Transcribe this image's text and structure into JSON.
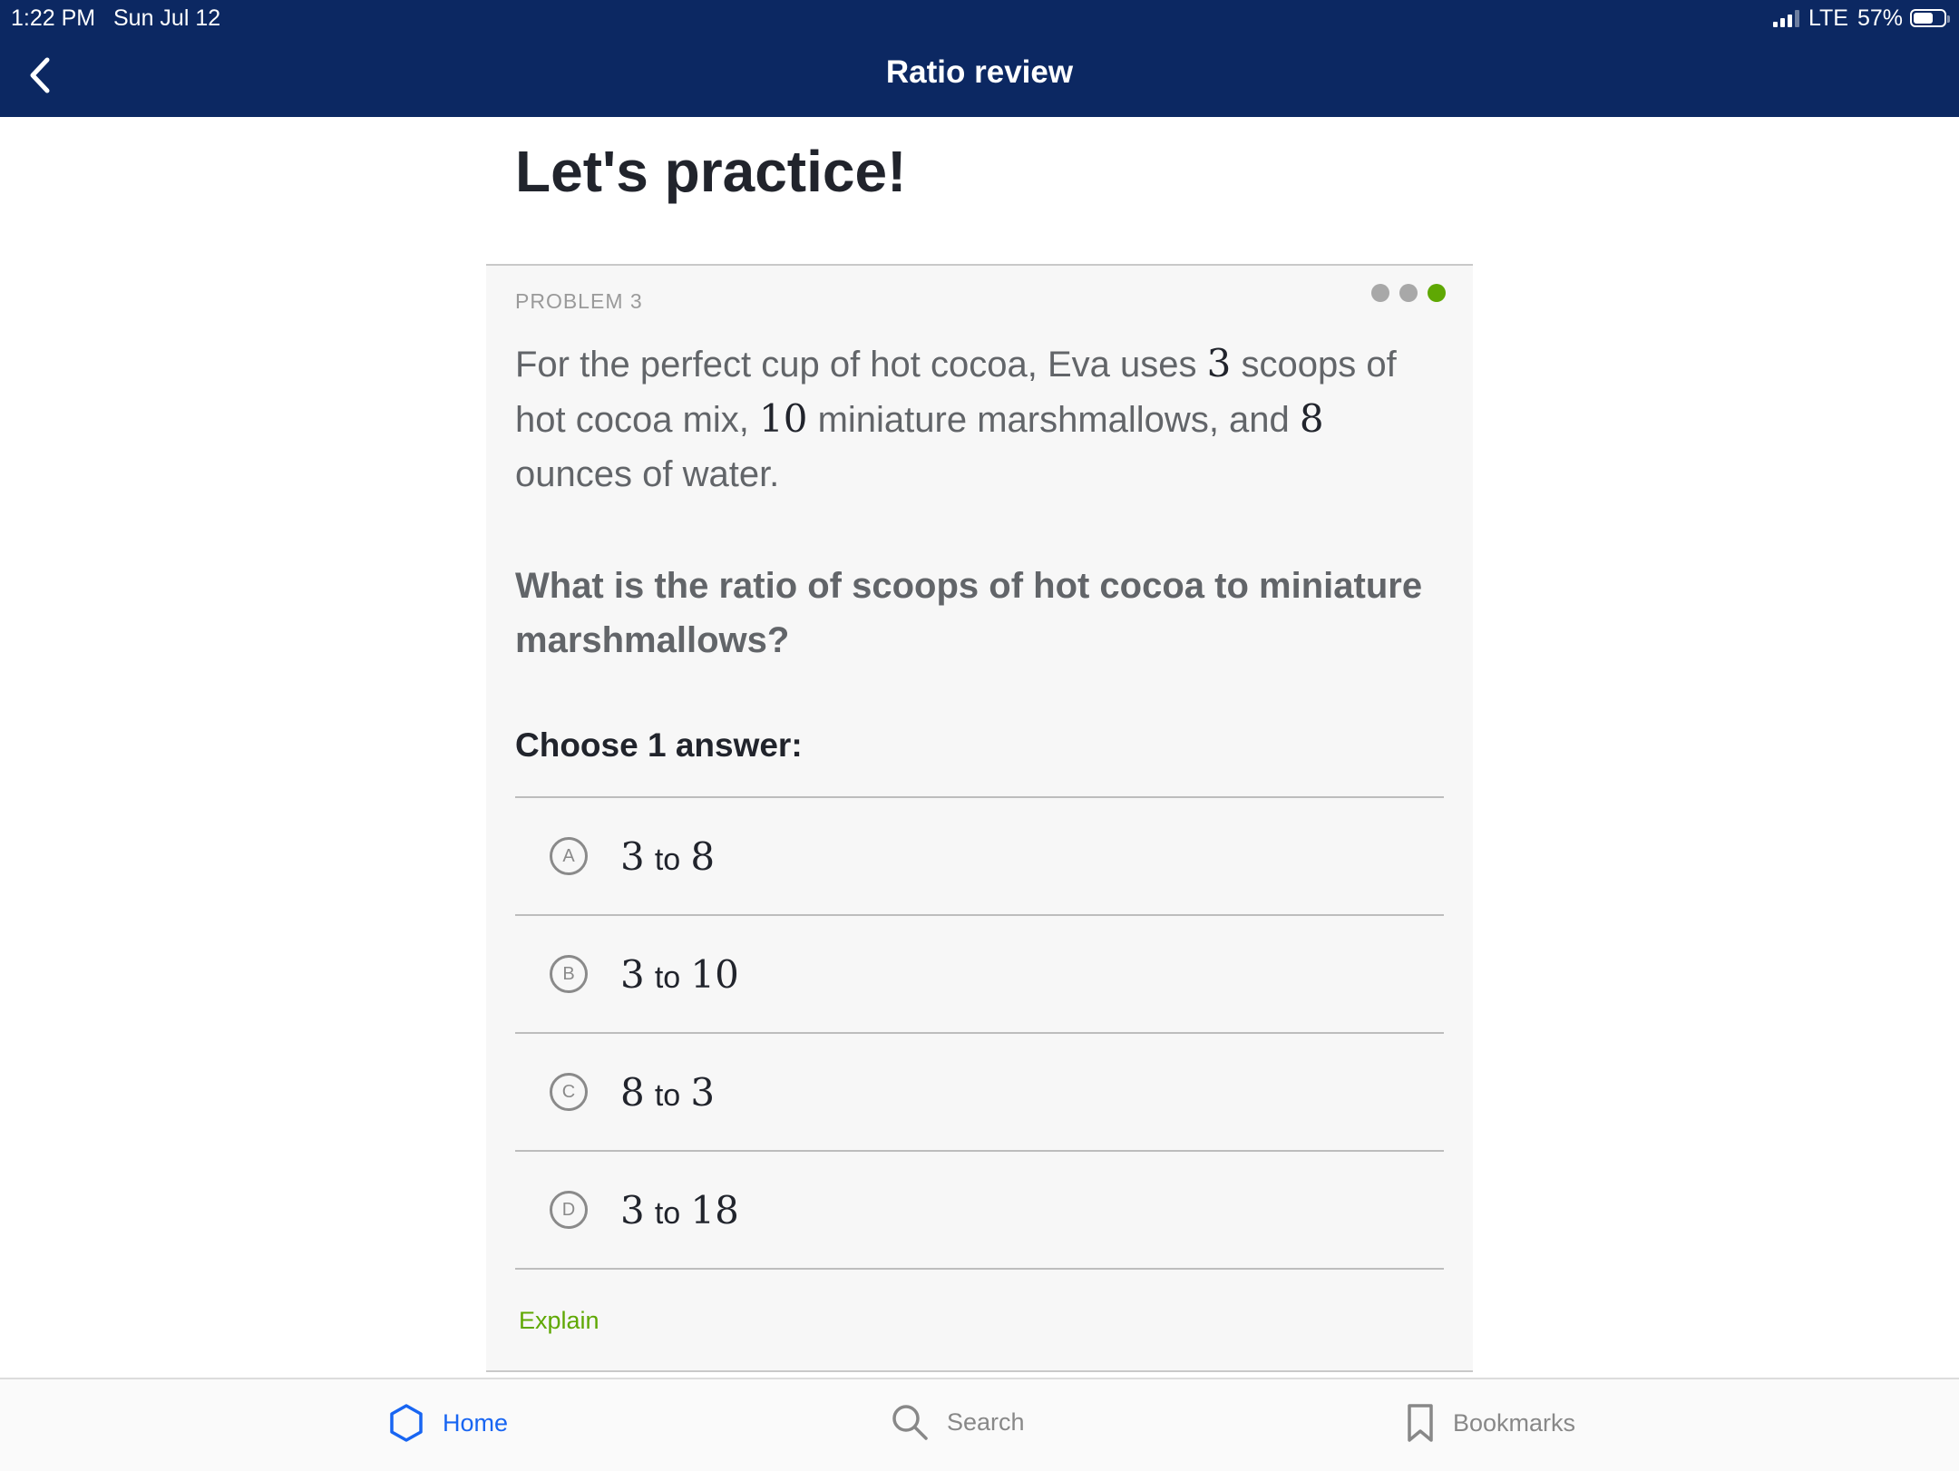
{
  "status": {
    "time": "1:22 PM",
    "date": "Sun Jul 12",
    "network": "LTE",
    "battery": "57%"
  },
  "nav": {
    "title": "Ratio review",
    "back_icon": "chevron-left-icon"
  },
  "page": {
    "heading": "Let's practice!"
  },
  "problem": {
    "label": "PROBLEM 3",
    "progress_dots": 3,
    "active_dot": 3,
    "text_parts": [
      "For the perfect cup of hot cocoa, Eva uses ",
      "3",
      " scoops of hot cocoa mix, ",
      "10",
      " miniature marshmallows, and ",
      "8",
      " ounces of water."
    ],
    "question": "What is the ratio of scoops of hot cocoa to miniature marshmallows?",
    "choose_label": "Choose 1 answer:",
    "choices": [
      {
        "letter": "A",
        "left": "3",
        "word": "to",
        "right": "8"
      },
      {
        "letter": "B",
        "left": "3",
        "word": "to",
        "right": "10"
      },
      {
        "letter": "C",
        "left": "8",
        "word": "to",
        "right": "3"
      },
      {
        "letter": "D",
        "left": "3",
        "word": "to",
        "right": "18"
      }
    ],
    "explain_label": "Explain"
  },
  "tabbar": {
    "home": {
      "label": "Home",
      "icon": "hexagon-icon"
    },
    "search": {
      "label": "Search",
      "icon": "search-icon"
    },
    "bookmarks": {
      "label": "Bookmarks",
      "icon": "bookmark-icon"
    }
  },
  "colors": {
    "header_bg": "#0c2862",
    "accent_green": "#5fa803",
    "accent_blue": "#1865f2"
  }
}
